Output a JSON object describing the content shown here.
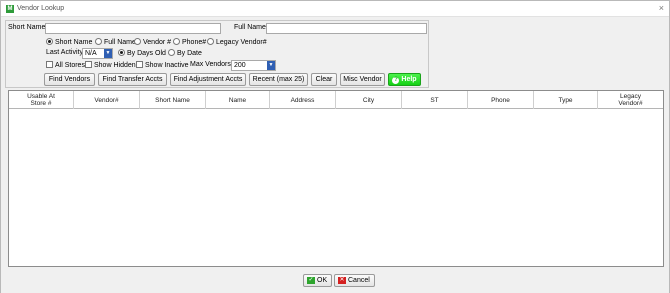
{
  "window": {
    "title": "Vendor Lookup",
    "close_glyph": "×",
    "app_icon_glyph": "M"
  },
  "search": {
    "short_name_label": "Short Name",
    "short_name_value": "",
    "full_name_label": "Full Name",
    "full_name_value": "",
    "search_by": [
      {
        "label": "Short Name",
        "selected": true
      },
      {
        "label": "Full Name",
        "selected": false
      },
      {
        "label": "Vendor #",
        "selected": false
      },
      {
        "label": "Phone#",
        "selected": false
      },
      {
        "label": "Legacy Vendor#",
        "selected": false
      }
    ],
    "last_activity_label": "Last Activity",
    "last_activity_value": "N/A",
    "by_days_old_label": "By Days Old",
    "by_date_label": "By Date",
    "all_stores_label": "All Stores",
    "show_hidden_label": "Show Hidden",
    "show_inactive_label": "Show Inactive",
    "max_vendors_label": "Max Vendors:",
    "max_vendors_value": "200"
  },
  "buttons": {
    "find_vendors": "Find Vendors",
    "find_transfer": "Find Transfer Accts",
    "find_adjustment": "Find Adjustment Accts",
    "recent": "Recent (max 25)",
    "clear": "Clear",
    "misc_vendor": "Misc Vendor",
    "help": "Help"
  },
  "grid": {
    "columns": [
      "Usable At\nStore #",
      "Vendor#",
      "Short Name",
      "Name",
      "Address",
      "City",
      "ST",
      "Phone",
      "Type",
      "Legacy\nVendor#"
    ],
    "rows": []
  },
  "footer": {
    "ok": "OK",
    "cancel": "Cancel"
  },
  "colors": {
    "help_green": "#22dd22",
    "ok_green": "#2ea52e",
    "cancel_red": "#d42020",
    "combo_blue": "#2f5fb3"
  }
}
